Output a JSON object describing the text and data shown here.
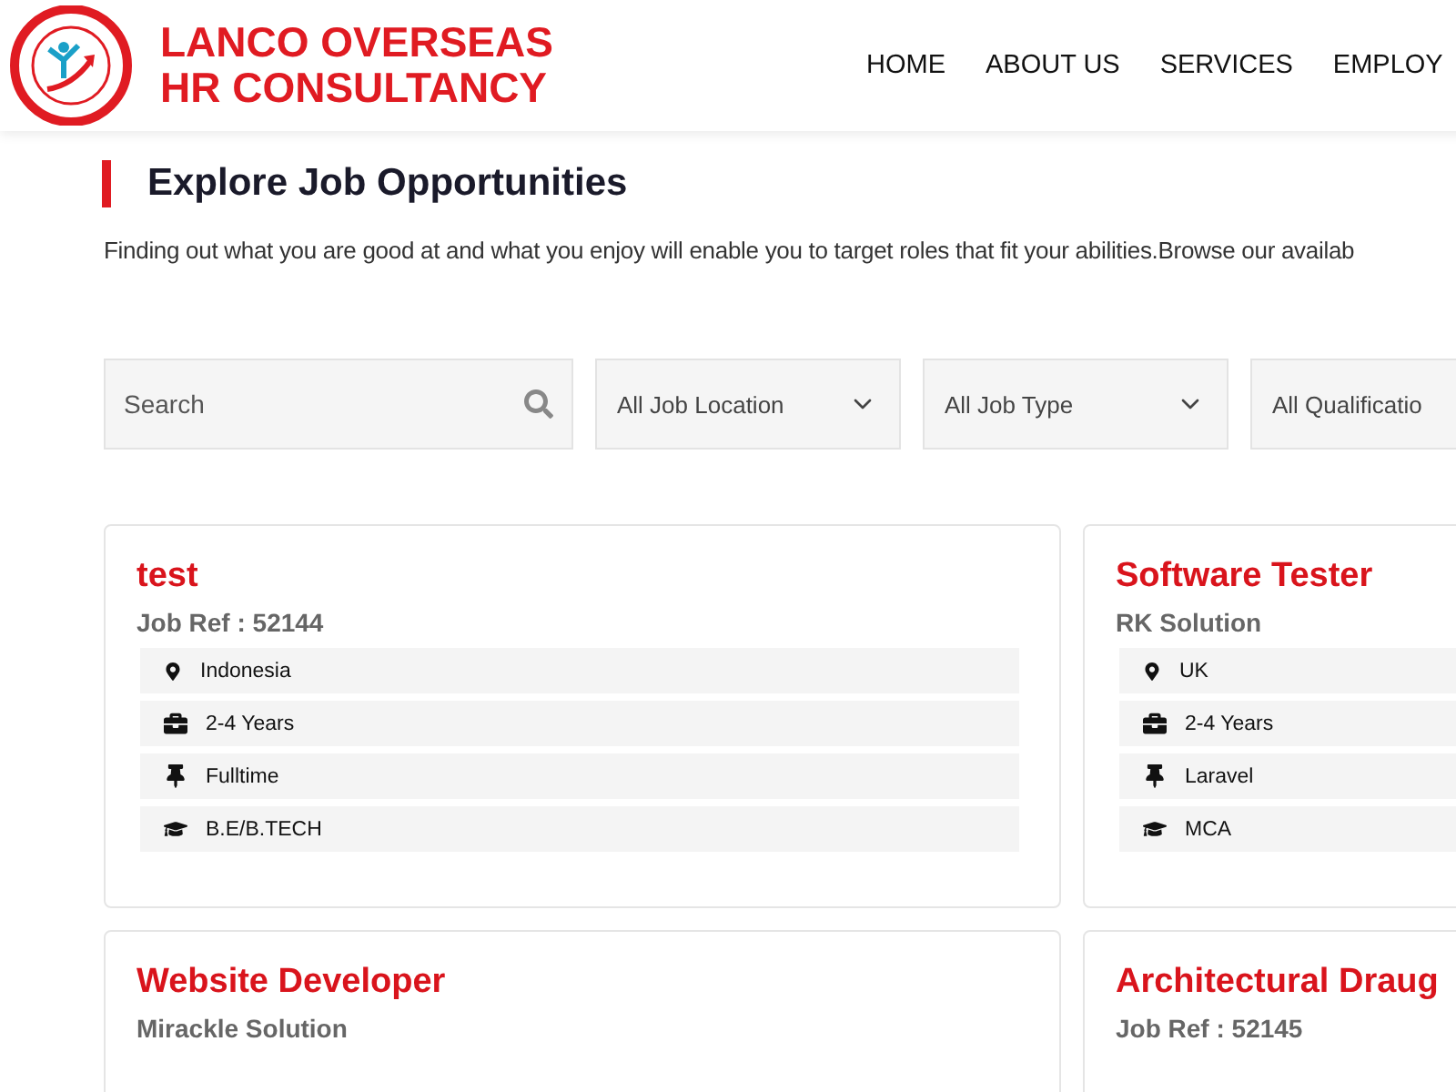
{
  "header": {
    "brand_line_1": "LANCO OVERSEAS",
    "brand_line_2": "HR CONSULTANCY",
    "nav": [
      {
        "label": "HOME"
      },
      {
        "label": "ABOUT US"
      },
      {
        "label": "SERVICES"
      },
      {
        "label": "EMPLOY"
      }
    ]
  },
  "section": {
    "title": "Explore Job Opportunities",
    "intro": "Finding out what you are good at and what you enjoy will enable you to target roles that fit your abilities.Browse our availab"
  },
  "filters": {
    "search": {
      "placeholder": "Search"
    },
    "dropdowns": [
      {
        "value": "All Job Location"
      },
      {
        "value": "All Job Type"
      },
      {
        "value": "All Qualificatio"
      }
    ]
  },
  "jobs": [
    {
      "title": "test",
      "subtitle": "Job Ref : 52144",
      "details": [
        {
          "kind": "location",
          "text": "Indonesia"
        },
        {
          "kind": "experience",
          "text": "2-4 Years"
        },
        {
          "kind": "type",
          "text": "Fulltime"
        },
        {
          "kind": "qualification",
          "text": "B.E/B.TECH"
        }
      ]
    },
    {
      "title": "Software Tester",
      "subtitle": "RK Solution",
      "details": [
        {
          "kind": "location",
          "text": "UK"
        },
        {
          "kind": "experience",
          "text": "2-4 Years"
        },
        {
          "kind": "type",
          "text": "Laravel"
        },
        {
          "kind": "qualification",
          "text": "MCA"
        }
      ]
    },
    {
      "title": "Website Developer",
      "subtitle": "Mirackle Solution"
    },
    {
      "title": "Architectural Draug",
      "subtitle": "Job Ref : 52145"
    }
  ]
}
